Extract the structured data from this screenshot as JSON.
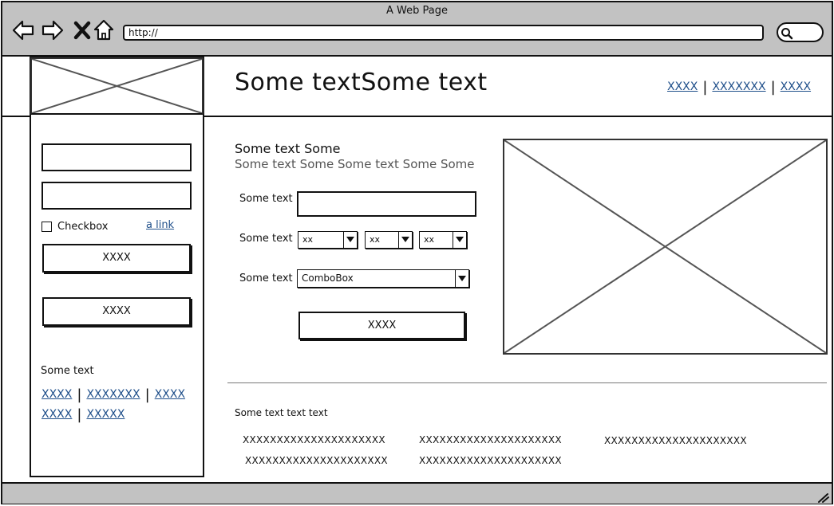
{
  "window": {
    "title": "A Web Page"
  },
  "browser": {
    "url": "http://"
  },
  "header": {
    "title": "Some textSome text",
    "links": [
      "XXXX",
      "XXXXXXX",
      "XXXX"
    ]
  },
  "sidebar": {
    "checkbox_label": "Checkbox",
    "link": "a link",
    "button1": "XXXX",
    "button2": "XXXX",
    "heading": "Some text",
    "links_row1": [
      "XXXX",
      "XXXXXXX",
      "XXXX"
    ],
    "links_row2": [
      "XXXX",
      "XXXXX"
    ]
  },
  "form": {
    "title": "Some text Some",
    "subtitle": "Some text Some Some text Some Some",
    "label1": "Some text",
    "label2": "Some text",
    "label3": "Some text",
    "select1": "xx",
    "select2": "xx",
    "select3": "xx",
    "combobox": "ComboBox",
    "submit": "XXXX"
  },
  "footer": {
    "heading": "Some text text text",
    "items": [
      "XXXXXXXXXXXXXXXXXXXXX",
      "XXXXXXXXXXXXXXXXXXXXX",
      "XXXXXXXXXXXXXXXXXXXXX",
      "XXXXXXXXXXXXXXXXXXXXX",
      "XXXXXXXXXXXXXXXXXXXXX"
    ]
  },
  "icons": [
    "back-arrow-icon",
    "forward-arrow-icon",
    "close-icon",
    "home-icon",
    "search-icon",
    "resize-grip-icon"
  ],
  "colors": {
    "chrome": "#c2c2c2",
    "link": "#1f4f8a",
    "subtitle": "#555555"
  }
}
